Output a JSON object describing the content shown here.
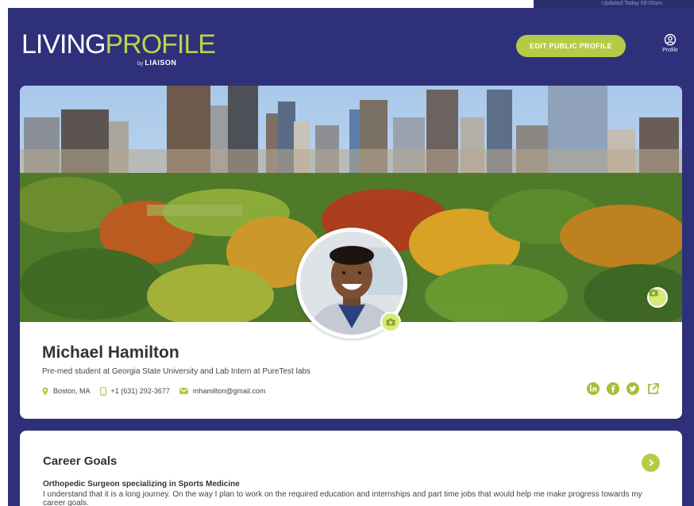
{
  "top_strip": {
    "text": "Updated Today 09:00am"
  },
  "header": {
    "logo_living": "LIVING",
    "logo_profile": "PROFILE",
    "logo_by": "by",
    "logo_brand": "LIAISON",
    "edit_button": "EDIT PUBLIC PROFILE",
    "profile_label": "Profile"
  },
  "profile": {
    "name": "Michael Hamilton",
    "headline": "Pre-med student at Georgia State University and Lab Intern at PureTest labs",
    "location": "Boston, MA",
    "phone": "+1 (631) 292-3677",
    "email": "mhamilton@gmail.com",
    "socials": [
      "linkedin-icon",
      "facebook-icon",
      "twitter-icon",
      "external-link-icon"
    ]
  },
  "career": {
    "title": "Career Goals",
    "goal": "Orthopedic Surgeon specializing in Sports Medicine",
    "description": "I understand that it is a long journey. On the way I plan to work on the required education and internships and part time jobs that would help me make progress towards my career goals."
  },
  "colors": {
    "navy": "#2f307a",
    "accent": "#b4cc45",
    "accent_light": "#d6ea79"
  }
}
